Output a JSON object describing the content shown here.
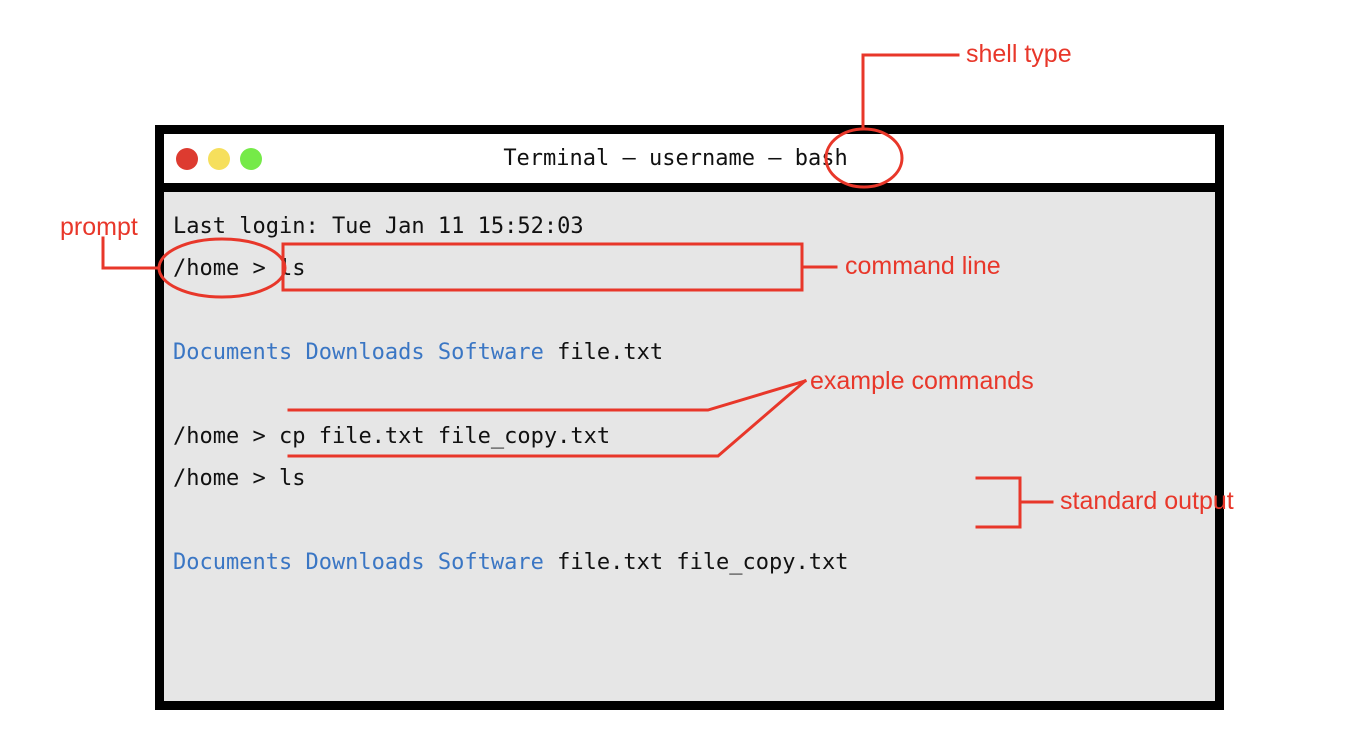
{
  "page": {
    "background": "#ffffff",
    "annotation_color": "#e8372a"
  },
  "terminal": {
    "window": {
      "frame_color": "#000000",
      "titlebar_background": "#ffffff",
      "body_background": "#e6e6e6"
    },
    "titlebar": {
      "title": "Terminal – username – bash",
      "traffic_lights": [
        {
          "name": "close",
          "color": "#dd3b30"
        },
        {
          "name": "minimize",
          "color": "#f6df5c"
        },
        {
          "name": "maximize",
          "color": "#75ea48"
        }
      ]
    },
    "prompt_text": "/home > ",
    "lines": [
      {
        "id": "last-login",
        "type": "output",
        "text": "Last login: Tue Jan 11 15:52:03"
      },
      {
        "id": "cmd-ls-1",
        "type": "command",
        "prompt": "/home > ",
        "command": "ls"
      },
      {
        "id": "blank-1",
        "type": "blank",
        "text": " "
      },
      {
        "id": "out-ls-1",
        "type": "output",
        "dirs": "Documents Downloads Software",
        "files": " file.txt"
      },
      {
        "id": "blank-2",
        "type": "blank",
        "text": " "
      },
      {
        "id": "cmd-cp",
        "type": "command",
        "prompt": "/home > ",
        "command": "cp file.txt file_copy.txt"
      },
      {
        "id": "cmd-ls-2",
        "type": "command",
        "prompt": "/home > ",
        "command": "ls"
      },
      {
        "id": "blank-3",
        "type": "blank",
        "text": " "
      },
      {
        "id": "out-ls-2",
        "type": "output",
        "dirs": "Documents Downloads Software",
        "files": " file.txt file_copy.txt"
      }
    ],
    "colors": {
      "text": "#111111",
      "directory": "#3a76c4",
      "file": "#111111"
    }
  },
  "annotations": [
    {
      "id": "shell-type",
      "label": "shell type",
      "marker": "ellipse",
      "target": "bash"
    },
    {
      "id": "prompt",
      "label": "prompt",
      "marker": "ellipse",
      "target": "/home >"
    },
    {
      "id": "command-line",
      "label": "command line",
      "marker": "rectangle",
      "target": "ls"
    },
    {
      "id": "example-commands",
      "label": "example commands",
      "marker": "underline",
      "target": "cp file.txt file_copy.txt / ls"
    },
    {
      "id": "standard-output",
      "label": "standard output",
      "marker": "bracket",
      "target": "Documents Downloads Software file.txt file_copy.txt"
    }
  ]
}
